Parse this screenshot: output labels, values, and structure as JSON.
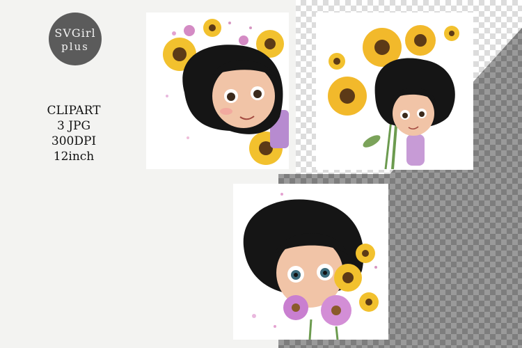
{
  "logo": {
    "line1": "SVGirl",
    "line2": "plus"
  },
  "info": {
    "line1": "CLIPART",
    "line2": "3 JPG",
    "line3": "300DPI",
    "line4": "12inch"
  },
  "colors": {
    "background": "#f3f3f1",
    "checker_dark": "#8c8c8c",
    "checker_light": "#ffffff",
    "logo_badge": "#5b5b5b"
  },
  "cards": [
    {
      "icon": "girl-sunflower-peek-illustration"
    },
    {
      "icon": "girl-sunflower-bouquet-illustration"
    },
    {
      "icon": "girl-flowers-closeup-illustration"
    }
  ]
}
